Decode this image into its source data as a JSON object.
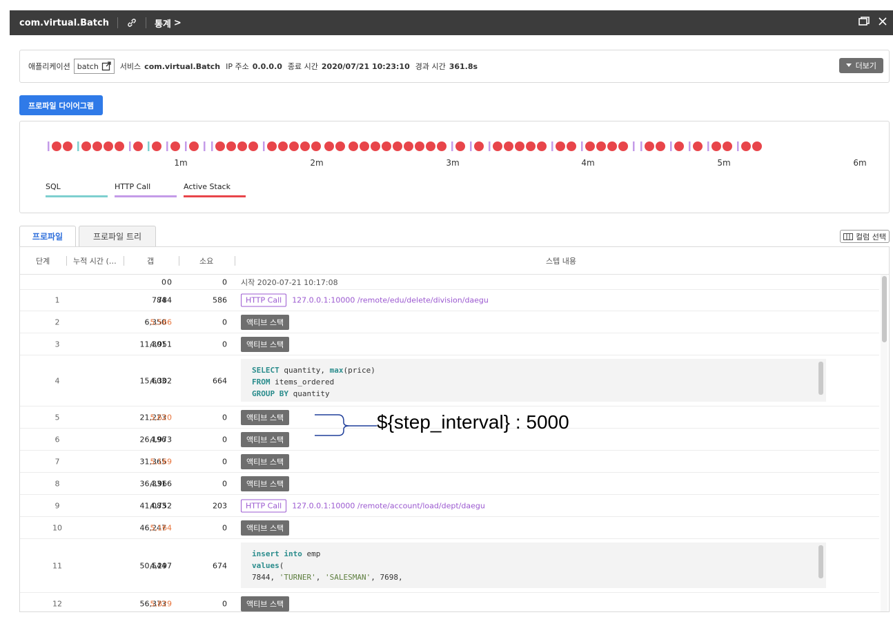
{
  "titlebar": {
    "app_name": "com.virtual.Batch",
    "stats_label": "통계",
    "stats_chevron": ">"
  },
  "info": {
    "app_label": "애플리케이션",
    "app_value": "batch",
    "service_label": "서비스",
    "service_value": "com.virtual.Batch",
    "ip_label": "IP 주소",
    "ip_value": "0.0.0.0",
    "end_label": "종료 시간",
    "end_value": "2020/07/21 10:23:10",
    "elapsed_label": "경과 시간",
    "elapsed_value": "361.8s",
    "more_label": "더보기"
  },
  "diagram_button": "프로파일 다이어그램",
  "timeline": {
    "axis_labels": [
      "1m",
      "2m",
      "3m",
      "4m",
      "5m",
      "6m"
    ],
    "legend": [
      {
        "name": "SQL",
        "color": "#7ecfcf"
      },
      {
        "name": "HTTP Call",
        "color": "#c49be8"
      },
      {
        "name": "Active Stack",
        "color": "#e8454a"
      }
    ],
    "colors": {
      "sql": "#7ecfcf",
      "http": "#c49be8",
      "active": "#e8454a"
    }
  },
  "tabs": {
    "profile": "프로파일",
    "tree": "프로파일 트리"
  },
  "column_select": "컬럼 선택",
  "headers": {
    "step": "단계",
    "cumulative": "누적 시간 (…",
    "gap": "갭",
    "duration": "소요",
    "content": "스텝 내용"
  },
  "labels": {
    "active_stack": "액티브 스택",
    "http_call": "HTTP Call"
  },
  "rows": [
    {
      "step": "",
      "cum": "0",
      "gap": "0",
      "dur": "0",
      "kind": "start",
      "text": "시작 2020-07-21 10:17:08"
    },
    {
      "step": "1",
      "cum": "784",
      "gap": "784",
      "dur": "586",
      "kind": "http",
      "text": "127.0.0.1:10000  /remote/edu/delete/division/daegu"
    },
    {
      "step": "2",
      "cum": "6,350",
      "gap": "5,566",
      "dur": "0",
      "kind": "active",
      "warn": true
    },
    {
      "step": "3",
      "cum": "11,301",
      "gap": "4,951",
      "dur": "0",
      "kind": "active"
    },
    {
      "step": "4",
      "cum": "15,603",
      "gap": "4,302",
      "dur": "664",
      "kind": "sql"
    },
    {
      "step": "5",
      "cum": "21,223",
      "gap": "5,620",
      "dur": "0",
      "kind": "active",
      "warn": true
    },
    {
      "step": "6",
      "cum": "26,196",
      "gap": "4,973",
      "dur": "0",
      "kind": "active"
    },
    {
      "step": "7",
      "cum": "31,365",
      "gap": "5,169",
      "dur": "0",
      "kind": "active",
      "warn": true
    },
    {
      "step": "8",
      "cum": "36,331",
      "gap": "4,966",
      "dur": "0",
      "kind": "active"
    },
    {
      "step": "9",
      "cum": "41,083",
      "gap": "4,752",
      "dur": "203",
      "kind": "http",
      "text": "127.0.0.1:10000  /remote/account/load/dept/daegu"
    },
    {
      "step": "10",
      "cum": "46,247",
      "gap": "5,164",
      "dur": "0",
      "kind": "active",
      "warn": true
    },
    {
      "step": "11",
      "cum": "50,544",
      "gap": "4,297",
      "dur": "674",
      "kind": "sql"
    },
    {
      "step": "12",
      "cum": "56,373",
      "gap": "5,829",
      "dur": "0",
      "kind": "active",
      "warn": true
    }
  ],
  "sql1": {
    "l1_kw": "SELECT",
    "l1_rest": " quantity, ",
    "l1_fn": "max",
    "l1_tail": "(price)",
    "l2_kw": "FROM",
    "l2_rest": " items_ordered",
    "l3_kw": "GROUP BY",
    "l3_rest": " quantity"
  },
  "sql2": {
    "l1_kw": "insert into",
    "l1_rest": " emp",
    "l2_kw": "values",
    "l2_rest": "(",
    "l3": "7844, ",
    "l3_s1": "'TURNER'",
    "l3_c": ", ",
    "l3_s2": "'SALESMAN'",
    "l3_t": ", 7698,"
  },
  "annotation": "${step_interval} : 5000"
}
